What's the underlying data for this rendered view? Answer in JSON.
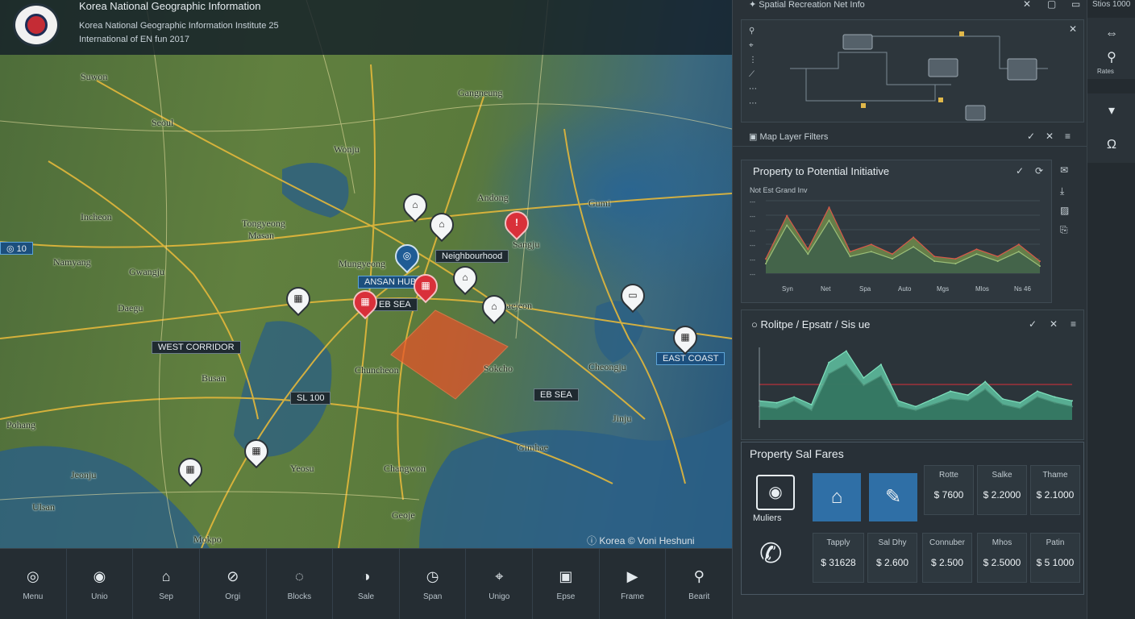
{
  "banner": {
    "title": "Korea National Geographic Information",
    "line2": "Korea National Geographic Information Institute 25",
    "line3": "International of EN fun 2017"
  },
  "map": {
    "labels": [
      "Suwon",
      "Seoul",
      "Incheon",
      "Namyang",
      "Gwangju",
      "Daegu",
      "Busan",
      "Pohang",
      "Ulsan",
      "Mokpo",
      "Jeonju",
      "Yeosu",
      "Changwon",
      "Gimhae",
      "Jinju",
      "Cheongju",
      "Daejeon",
      "Gumi",
      "Andong",
      "Gangneung",
      "Wonju",
      "Chuncheon",
      "Sokcho",
      "Geoje",
      "Tongyeong",
      "Masan",
      "Sangju",
      "Mungyeong"
    ],
    "tags": {
      "left_edge": "◎ 10",
      "seoul_tag": "Neighbourhood",
      "incheon_tag": "ANSAN HUB",
      "central_tag": "EB SEA",
      "west_tag": "WEST CORRIDOR",
      "south_tag": "SL 100",
      "east_tag": "EAST COAST",
      "se_tag": "EB SEA"
    },
    "credits": "Korea © Voni Heshuni"
  },
  "toolbar": [
    {
      "label": "Menu",
      "icon": "target-icon"
    },
    {
      "label": "Unio",
      "icon": "record-icon"
    },
    {
      "label": "Sep",
      "icon": "home-icon"
    },
    {
      "label": "Orgi",
      "icon": "compass-icon"
    },
    {
      "label": "Blocks",
      "icon": "chat-icon"
    },
    {
      "label": "Sale",
      "icon": "pie-icon"
    },
    {
      "label": "Span",
      "icon": "timer-icon"
    },
    {
      "label": "Unigo",
      "icon": "location-icon"
    },
    {
      "label": "Epse",
      "icon": "camera-icon"
    },
    {
      "label": "Frame",
      "icon": "play-icon"
    },
    {
      "label": "Bearit",
      "icon": "satellite-icon"
    }
  ],
  "panel": {
    "top_title": "Spatial Recreation Net Info",
    "layer_header": "Map Layer Filters",
    "chart1_title": "Property to Potential Initiative",
    "chart1_subtitle": "Not Est Grand Inv",
    "chart1_xticks": [
      "Syn",
      "Net",
      "Spa",
      "Auto",
      "Mgs",
      "Mlos",
      "Ns 46"
    ],
    "chart2_title": "Rolitpe / Epsatr / Sis ue",
    "stats_title": "Property Sal Fares",
    "metric_label": "Muliers",
    "top_cells": [
      {
        "key": "Rotte",
        "value": "$ 7600"
      },
      {
        "key": "Salke",
        "value": "$ 2.2000"
      },
      {
        "key": "Thame",
        "value": "$ 2.1000"
      }
    ],
    "bottom_cells": [
      {
        "key": "Tapply",
        "value": "$ 31628"
      },
      {
        "key": "Sal Dhy",
        "value": "$ 2.600"
      },
      {
        "key": "Connuber",
        "value": "$ 2.500"
      },
      {
        "key": "Mhos",
        "value": "$ 2.5000"
      },
      {
        "key": "Patin",
        "value": "$ 5 1000"
      }
    ]
  },
  "rail": {
    "top_text": "Stios 1000",
    "rail_label": "Rates"
  },
  "chart_data": [
    {
      "type": "area",
      "title": "Property to Potential Initiative",
      "xlabel": "",
      "ylabel": "",
      "x": [
        "Syn",
        "Net",
        "Spa",
        "Auto",
        "Mgs",
        "Mlos",
        "Ns 46"
      ],
      "series": [
        {
          "values": [
            12,
            48,
            20,
            55,
            18,
            24,
            16,
            30,
            14,
            12,
            20,
            14,
            24,
            10
          ]
        },
        {
          "values": [
            8,
            40,
            16,
            44,
            14,
            18,
            12,
            22,
            10,
            8,
            16,
            10,
            18,
            6
          ]
        }
      ]
    },
    {
      "type": "area",
      "title": "Rolitpe / Epsatr / Sis ue",
      "xlabel": "",
      "ylabel": "",
      "series": [
        {
          "values": [
            20,
            18,
            24,
            16,
            60,
            72,
            44,
            58,
            20,
            14,
            22,
            30,
            26,
            40,
            22,
            18,
            30,
            24,
            20
          ]
        },
        {
          "values": [
            14,
            12,
            20,
            10,
            48,
            58,
            36,
            46,
            14,
            10,
            16,
            22,
            20,
            32,
            16,
            12,
            24,
            18,
            14
          ]
        }
      ]
    }
  ],
  "colors": {
    "accent_blue": "#2f6fa6",
    "alert_red": "#d9303a",
    "chart_green": "#5fc3a2",
    "chart_olive": "#6f8b4b"
  }
}
